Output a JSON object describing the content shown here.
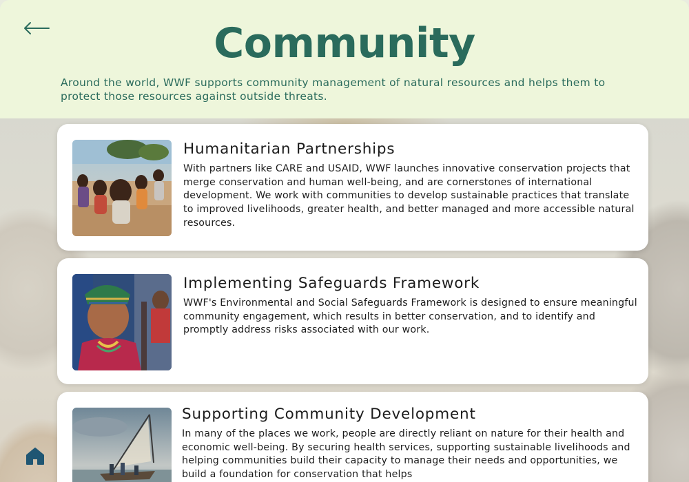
{
  "header": {
    "title": "Community",
    "intro": "Around the world, WWF supports community management of natural resources and helps them to protect those resources against outside threats."
  },
  "nav": {
    "back_icon": "arrow-left-icon",
    "home_icon": "home-icon"
  },
  "cards": [
    {
      "title": "Humanitarian Partnerships",
      "text": "With partners like CARE and USAID, WWF launches innovative conservation projects that merge conservation and human well-being, and are cornerstones of international development. We work with communities to develop sustainable practices that translate to improved livelihoods, greater health, and better managed and more accessible natural resources."
    },
    {
      "title": "Implementing Safeguards Framework",
      "text": "WWF's Environmental and Social Safeguards Framework is designed to ensure meaningful community engagement, which results in better conservation, and to identify and promptly address risks associated with our work."
    },
    {
      "title": "Supporting Community Development",
      "text": "In many of the places we work, people are directly reliant on nature for their health and economic well-being. By securing health services, supporting sustainable livelihoods and helping communities build their capacity to manage their needs and opportunities, we build a foundation for conservation that helps"
    }
  ],
  "colors": {
    "accent": "#2a6b5c",
    "header_bg": "#eef6db",
    "card_bg": "#ffffff",
    "text": "#1c1c1c"
  }
}
